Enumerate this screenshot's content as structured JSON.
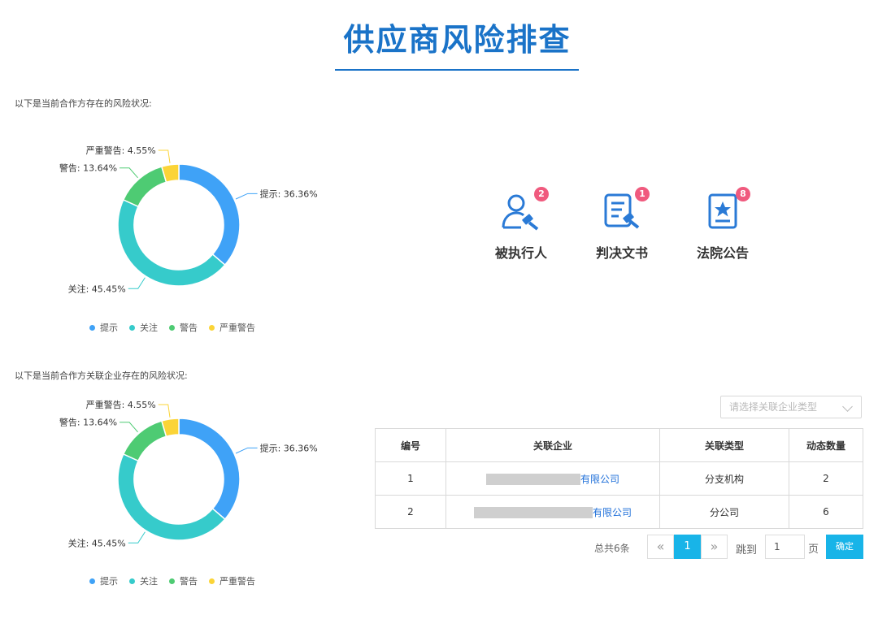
{
  "page": {
    "title": "供应商风险排查"
  },
  "section1": {
    "label": "以下是当前合作方存在的风险状况:"
  },
  "section2": {
    "label": "以下是当前合作方关联企业存在的风险状况:"
  },
  "legend": [
    {
      "name": "提示",
      "color": "#3fa2f7"
    },
    {
      "name": "关注",
      "color": "#36cbcb"
    },
    {
      "name": "警告",
      "color": "#4ecb73"
    },
    {
      "name": "严重警告",
      "color": "#fbd437"
    }
  ],
  "chart_data": [
    {
      "type": "pie",
      "slices": [
        {
          "name": "提示",
          "value": 36.36,
          "color": "#3fa2f7",
          "label": "提示: 36.36%"
        },
        {
          "name": "关注",
          "value": 45.45,
          "color": "#36cbcb",
          "label": "关注: 45.45%"
        },
        {
          "name": "警告",
          "value": 13.64,
          "color": "#4ecb73",
          "label": "警告: 13.64%"
        },
        {
          "name": "严重警告",
          "value": 4.55,
          "color": "#fbd437",
          "label": "严重警告: 4.55%"
        }
      ],
      "legend_position": "bottom"
    },
    {
      "type": "pie",
      "slices": [
        {
          "name": "提示",
          "value": 36.36,
          "color": "#3fa2f7",
          "label": "提示: 36.36%"
        },
        {
          "name": "关注",
          "value": 45.45,
          "color": "#36cbcb",
          "label": "关注: 45.45%"
        },
        {
          "name": "警告",
          "value": 13.64,
          "color": "#4ecb73",
          "label": "警告: 13.64%"
        },
        {
          "name": "严重警告",
          "value": 4.55,
          "color": "#fbd437",
          "label": "严重警告: 4.55%"
        }
      ],
      "legend_position": "bottom"
    }
  ],
  "risk_cards": [
    {
      "label": "被执行人",
      "badge": "2",
      "icon": "person-gavel-icon"
    },
    {
      "label": "判决文书",
      "badge": "1",
      "icon": "document-gavel-icon"
    },
    {
      "label": "法院公告",
      "badge": "8",
      "icon": "notice-star-icon"
    }
  ],
  "filter": {
    "placeholder": "请选择关联企业类型"
  },
  "table": {
    "headers": [
      "编号",
      "关联企业",
      "关联类型",
      "动态数量"
    ],
    "rows": [
      {
        "id": "1",
        "company_suffix": "有限公司",
        "type": "分支机构",
        "count": "2"
      },
      {
        "id": "2",
        "company_suffix": "有限公司",
        "type": "分公司",
        "count": "6"
      }
    ]
  },
  "pagination": {
    "total_text": "总共6条",
    "prev": "«",
    "current": "1",
    "next": "»",
    "jump_label": "跳到",
    "jump_value": "1",
    "page_unit": "页",
    "confirm_label": "确定"
  },
  "colors": {
    "accent": "#1a73c8",
    "badge": "#f05a7e",
    "link": "#1e6fd9",
    "confirm": "#18b4e8"
  }
}
